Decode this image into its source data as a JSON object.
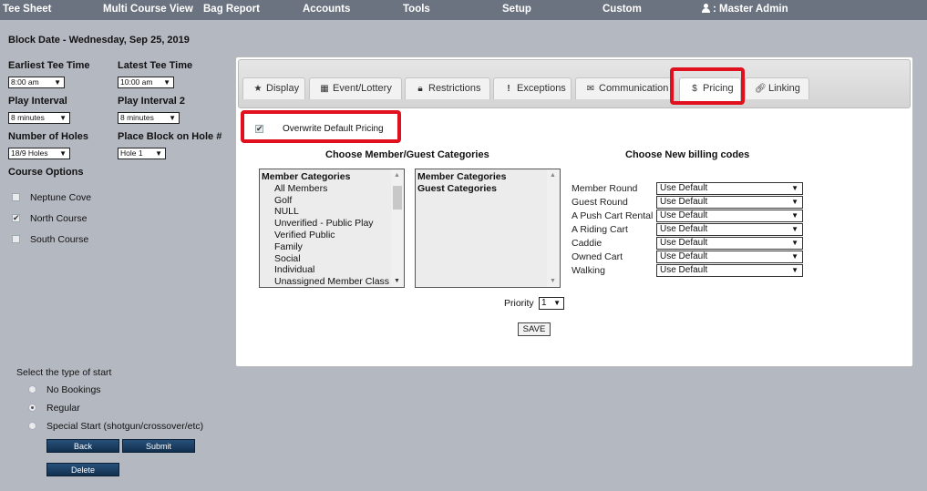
{
  "nav": {
    "items": [
      "Tee Sheet",
      "Multi Course View",
      "Bag Report",
      "Accounts",
      "Tools",
      "Setup",
      "Custom"
    ],
    "user": ": Master Admin"
  },
  "left": {
    "block_date": "Block Date - Wednesday, Sep 25, 2019",
    "earliest_label": "Earliest Tee Time",
    "earliest_value": "8:00 am",
    "latest_label": "Latest Tee Time",
    "latest_value": "10:00 am",
    "interval_label": "Play Interval",
    "interval_value": "8 minutes",
    "interval2_label": "Play Interval 2",
    "interval2_value": "8 minutes",
    "holes_label": "Number of Holes",
    "holes_value": "18/9 Holes",
    "place_label": "Place Block on Hole #",
    "place_value": "Hole 1",
    "course_options_label": "Course Options",
    "courses": [
      {
        "name": "Neptune Cove",
        "checked": false
      },
      {
        "name": "North Course",
        "checked": true
      },
      {
        "name": "South Course",
        "checked": false
      }
    ],
    "start_type_label": "Select the type of start",
    "start_types": [
      "No Bookings",
      "Regular",
      "Special Start (shotgun/crossover/etc)"
    ],
    "selected_start": "Regular",
    "back_label": "Back",
    "submit_label": "Submit",
    "delete_label": "Delete"
  },
  "tabs": [
    {
      "label": "Display",
      "icon": "star-icon"
    },
    {
      "label": "Event/Lottery",
      "icon": "calendar-icon"
    },
    {
      "label": "Restrictions",
      "icon": "lock-icon"
    },
    {
      "label": "Exceptions",
      "icon": "exclamation-icon"
    },
    {
      "label": "Communication",
      "icon": "envelope-icon"
    },
    {
      "label": "Pricing",
      "icon": "dollar-icon"
    },
    {
      "label": "Linking",
      "icon": "link-icon"
    }
  ],
  "active_tab": "Pricing",
  "highlight_color": "#e0101e",
  "pricing": {
    "overwrite_label": "Overwrite Default Pricing",
    "overwrite_checked": true,
    "choose_categories_title": "Choose Member/Guest Categories",
    "choose_billing_title": "Choose New billing codes",
    "available_list": [
      "Member Categories",
      "All Members",
      "Golf",
      "NULL",
      "Unverified - Public Play",
      "Verified Public",
      "Family",
      "Social",
      "Individual",
      "Unassigned Member Class"
    ],
    "selected_list": [
      "Member Categories",
      "Guest Categories"
    ],
    "priority_label": "Priority",
    "priority_value": "1",
    "save_label": "SAVE",
    "billing_codes": [
      {
        "label": "Member Round",
        "value": "Use Default"
      },
      {
        "label": "Guest Round",
        "value": "Use Default"
      },
      {
        "label": "A Push Cart Rental",
        "value": "Use Default"
      },
      {
        "label": "A Riding Cart",
        "value": "Use Default"
      },
      {
        "label": "Caddie",
        "value": "Use Default"
      },
      {
        "label": "Owned Cart",
        "value": "Use Default"
      },
      {
        "label": "Walking",
        "value": "Use Default"
      }
    ]
  }
}
